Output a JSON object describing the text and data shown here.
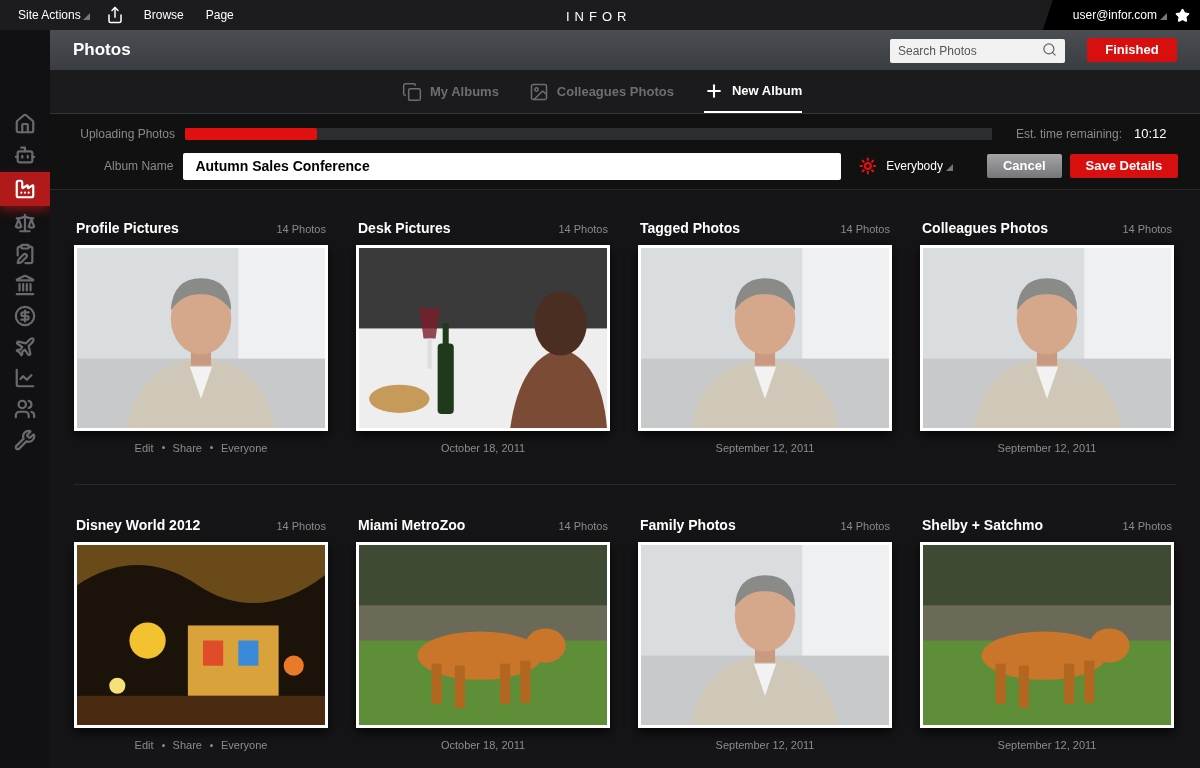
{
  "top_bar": {
    "menu": [
      {
        "label": "Site Actions",
        "kind": "dropdown"
      },
      {
        "kind": "share-icon"
      },
      {
        "label": "Browse",
        "kind": "link"
      },
      {
        "label": "Page",
        "kind": "link"
      }
    ],
    "logo": "INFOR",
    "user": "user@infor.com"
  },
  "sidebar": {
    "items": [
      {
        "selected": false
      },
      {
        "selected": false
      },
      {
        "selected": true
      },
      {
        "selected": false
      },
      {
        "selected": false
      },
      {
        "selected": false
      },
      {
        "selected": false
      },
      {
        "selected": false
      },
      {
        "selected": false
      },
      {
        "selected": false
      },
      {
        "selected": false
      }
    ]
  },
  "header": {
    "title": "Photos",
    "search": {
      "placeholder": "Search Photos"
    },
    "finished_button": "Finished"
  },
  "tabs": [
    {
      "label": "My Albums",
      "selected": false
    },
    {
      "label": "Colleagues Photos",
      "selected": false
    },
    {
      "label": "New Album",
      "selected": true
    }
  ],
  "upload": {
    "label": "Uploading Photos",
    "level": 0.164,
    "time_label": "Est. time remaining:",
    "time": "10:12"
  },
  "album_form": {
    "label": "Album Name",
    "value": "Autumn Sales Conference",
    "visibility": "Everybody",
    "cancel": "Cancel",
    "save": "Save Details"
  },
  "albums": [
    {
      "title": "Profile Pictures",
      "count": "14 Photos",
      "actions": [
        "Edit",
        "Share",
        "Everyone"
      ]
    },
    {
      "title": "Desk Pictures",
      "count": "14 Photos",
      "date": "October 18, 2011"
    },
    {
      "title": "Tagged Photos",
      "count": "14 Photos",
      "date": "September 12, 2011"
    },
    {
      "title": "Colleagues Photos",
      "count": "14 Photos",
      "date": "September 12, 2011"
    },
    {
      "title": "Disney World 2012",
      "count": "14 Photos",
      "kind": "picture",
      "actions": [
        "Edit",
        "Share",
        "Everyone"
      ]
    },
    {
      "title": "Miami MetroZoo",
      "count": "14 Photos",
      "date": "October 18, 2011"
    },
    {
      "title": "Family Photos",
      "count": "14 Photos",
      "date": "September 12, 2011"
    },
    {
      "title": "Shelby + Satchmo",
      "count": "14 Photos",
      "date": "September 12, 2011"
    }
  ]
}
